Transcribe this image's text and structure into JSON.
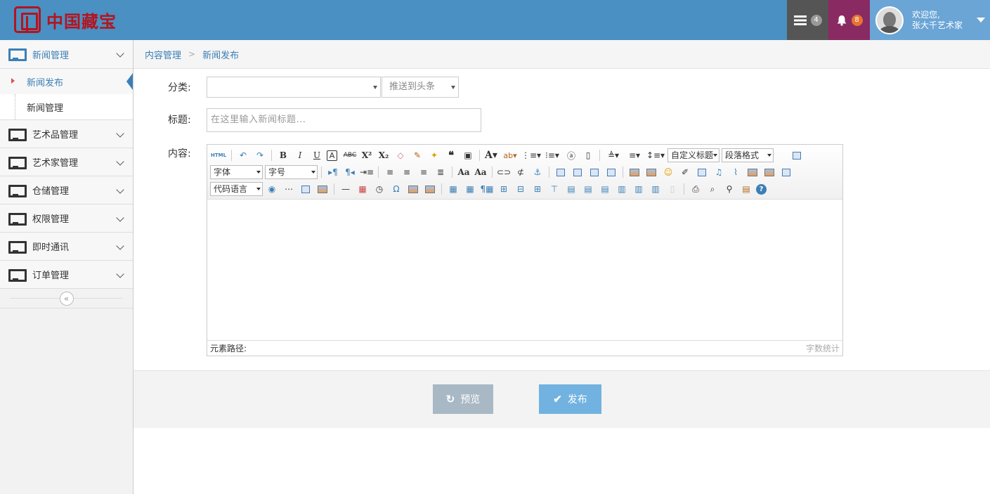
{
  "brand": {
    "name": "中国藏宝"
  },
  "header": {
    "messages_badge": "4",
    "notifications_badge": "8",
    "welcome_line1": "欢迎您,",
    "welcome_line2": "张大千艺术家"
  },
  "sidebar": {
    "menu": [
      {
        "label": "新闻管理",
        "open": true,
        "children": [
          {
            "label": "新闻发布",
            "active": true
          },
          {
            "label": "新闻管理",
            "active": false
          }
        ]
      },
      {
        "label": "艺术品管理"
      },
      {
        "label": "艺术家管理"
      },
      {
        "label": "仓储管理"
      },
      {
        "label": "权限管理"
      },
      {
        "label": "即时通讯"
      },
      {
        "label": "订单管理"
      }
    ],
    "collapse_glyph": "«"
  },
  "breadcrumb": {
    "items": [
      "内容管理",
      "新闻发布"
    ],
    "separator": ">"
  },
  "form": {
    "category_label": "分类:",
    "category_value": "",
    "push_placeholder": "推送到头条",
    "title_label": "标题:",
    "title_placeholder": "在这里输入新闻标题...",
    "content_label": "内容:"
  },
  "editor": {
    "selects": {
      "custom_title": "自定义标题",
      "paragraph": "段落格式",
      "font_family": "字体",
      "font_size": "字号",
      "code_lang": "代码语言"
    },
    "html_btn": "HTML",
    "status_left": "元素路径:",
    "status_right": "字数统计"
  },
  "actions": {
    "preview_label": "预览",
    "publish_label": "发布"
  },
  "colors": {
    "header_bg": "#4a90c2",
    "brand_red": "#b3141f",
    "messages_bg": "#555555",
    "notifications_bg": "#8a2a63",
    "user_bg": "#6aa5d6",
    "link_blue": "#3b7fb6",
    "preview_btn": "#a9b8c5",
    "publish_btn": "#72b2e0"
  }
}
